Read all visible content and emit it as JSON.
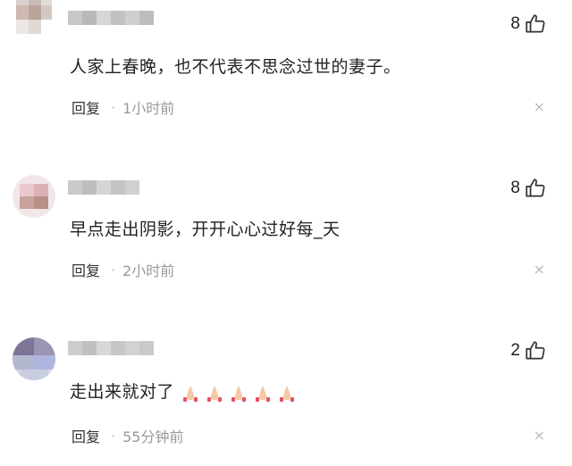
{
  "comments": [
    {
      "text": "人家上春晚，也不代表不思念过世的妻子。",
      "likes": "8",
      "reply_label": "回复",
      "separator": "·",
      "time": "1小时前",
      "close_glyph": "×"
    },
    {
      "text": "早点走出阴影，开开心心过好每_天",
      "likes": "8",
      "reply_label": "回复",
      "separator": "·",
      "time": "2小时前",
      "close_glyph": "×"
    },
    {
      "text": "走出来就对了",
      "emoji": "folded-hands-icon x5",
      "likes": "2",
      "reply_label": "回复",
      "separator": "·",
      "time": "55分钟前",
      "close_glyph": "×"
    }
  ],
  "icons": {
    "like": "thumbs-up-icon",
    "close": "close-icon",
    "emoji": "folded-hands-icon"
  },
  "colors": {
    "text": "#222222",
    "meta": "#999999",
    "divider": "#efefef"
  }
}
